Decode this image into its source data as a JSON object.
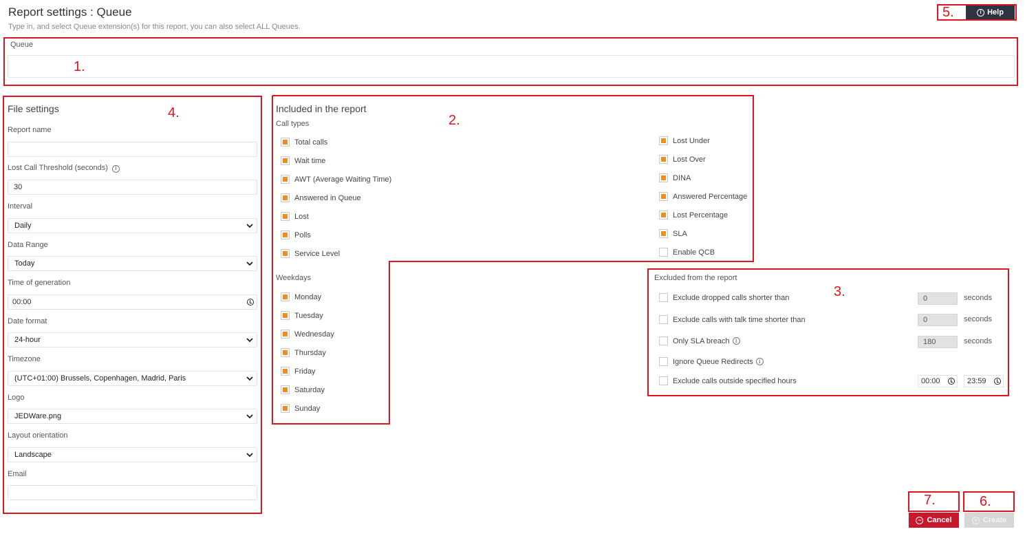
{
  "header": {
    "title": "Report settings : Queue",
    "subtitle": "Type in, and select Queue extension(s) for this report, you can also select ALL Queues.",
    "help_label": "Help"
  },
  "queue": {
    "label": "Queue",
    "value": ""
  },
  "file_settings": {
    "title": "File settings",
    "report_name_label": "Report name",
    "report_name_value": "",
    "threshold_label": "Lost Call Threshold (seconds)",
    "threshold_value": "30",
    "interval_label": "Interval",
    "interval_value": "Daily",
    "range_label": "Data Range",
    "range_value": "Today",
    "time_label": "Time of generation",
    "time_value": "00:00",
    "date_format_label": "Date format",
    "date_format_value": "24-hour",
    "timezone_label": "Timezone",
    "timezone_value": "(UTC+01:00) Brussels, Copenhagen, Madrid, Paris",
    "logo_label": "Logo",
    "logo_value": "JEDWare.png",
    "layout_label": "Layout orientation",
    "layout_value": "Landscape",
    "email_label": "Email",
    "email_value": ""
  },
  "included": {
    "title": "Included in the report",
    "call_types_label": "Call types",
    "call_types_left": [
      {
        "label": "Total calls",
        "checked": true
      },
      {
        "label": "Wait time",
        "checked": true
      },
      {
        "label": "AWT (Average Waiting Time)",
        "checked": true
      },
      {
        "label": "Answered in Queue",
        "checked": true
      },
      {
        "label": "Lost",
        "checked": true
      },
      {
        "label": "Polls",
        "checked": true
      },
      {
        "label": "Service Level",
        "checked": true
      }
    ],
    "call_types_right": [
      {
        "label": "Lost Under",
        "checked": true
      },
      {
        "label": "Lost Over",
        "checked": true
      },
      {
        "label": "DINA",
        "checked": true
      },
      {
        "label": "Answered Percentage",
        "checked": true
      },
      {
        "label": "Lost Percentage",
        "checked": true
      },
      {
        "label": "SLA",
        "checked": true
      },
      {
        "label": "Enable QCB",
        "checked": false
      }
    ],
    "weekdays_label": "Weekdays",
    "weekdays": [
      {
        "label": "Monday",
        "checked": true
      },
      {
        "label": "Tuesday",
        "checked": true
      },
      {
        "label": "Wednesday",
        "checked": true
      },
      {
        "label": "Thursday",
        "checked": true
      },
      {
        "label": "Friday",
        "checked": true
      },
      {
        "label": "Saturday",
        "checked": true
      },
      {
        "label": "Sunday",
        "checked": true
      }
    ]
  },
  "excluded": {
    "title": "Excluded from the report",
    "rows": [
      {
        "label": "Exclude dropped calls shorter than",
        "value": "0",
        "unit": "seconds"
      },
      {
        "label": "Exclude calls with talk time shorter than",
        "value": "0",
        "unit": "seconds"
      },
      {
        "label": "Only SLA breach",
        "value": "180",
        "unit": "seconds"
      },
      {
        "label": "Ignore Queue Redirects"
      },
      {
        "label": "Exclude calls outside specified hours",
        "from": "00:00",
        "to": "23:59"
      }
    ]
  },
  "actions": {
    "cancel_label": "Cancel",
    "create_label": "Create"
  },
  "annotations": [
    "1.",
    "2.",
    "3.",
    "4.",
    "5.",
    "6.",
    "7."
  ],
  "colors": {
    "annotation_red": "#e0141e",
    "checkbox_orange": "#f28c1d",
    "cancel_red": "#c8182c",
    "help_dark": "#2d3340"
  }
}
